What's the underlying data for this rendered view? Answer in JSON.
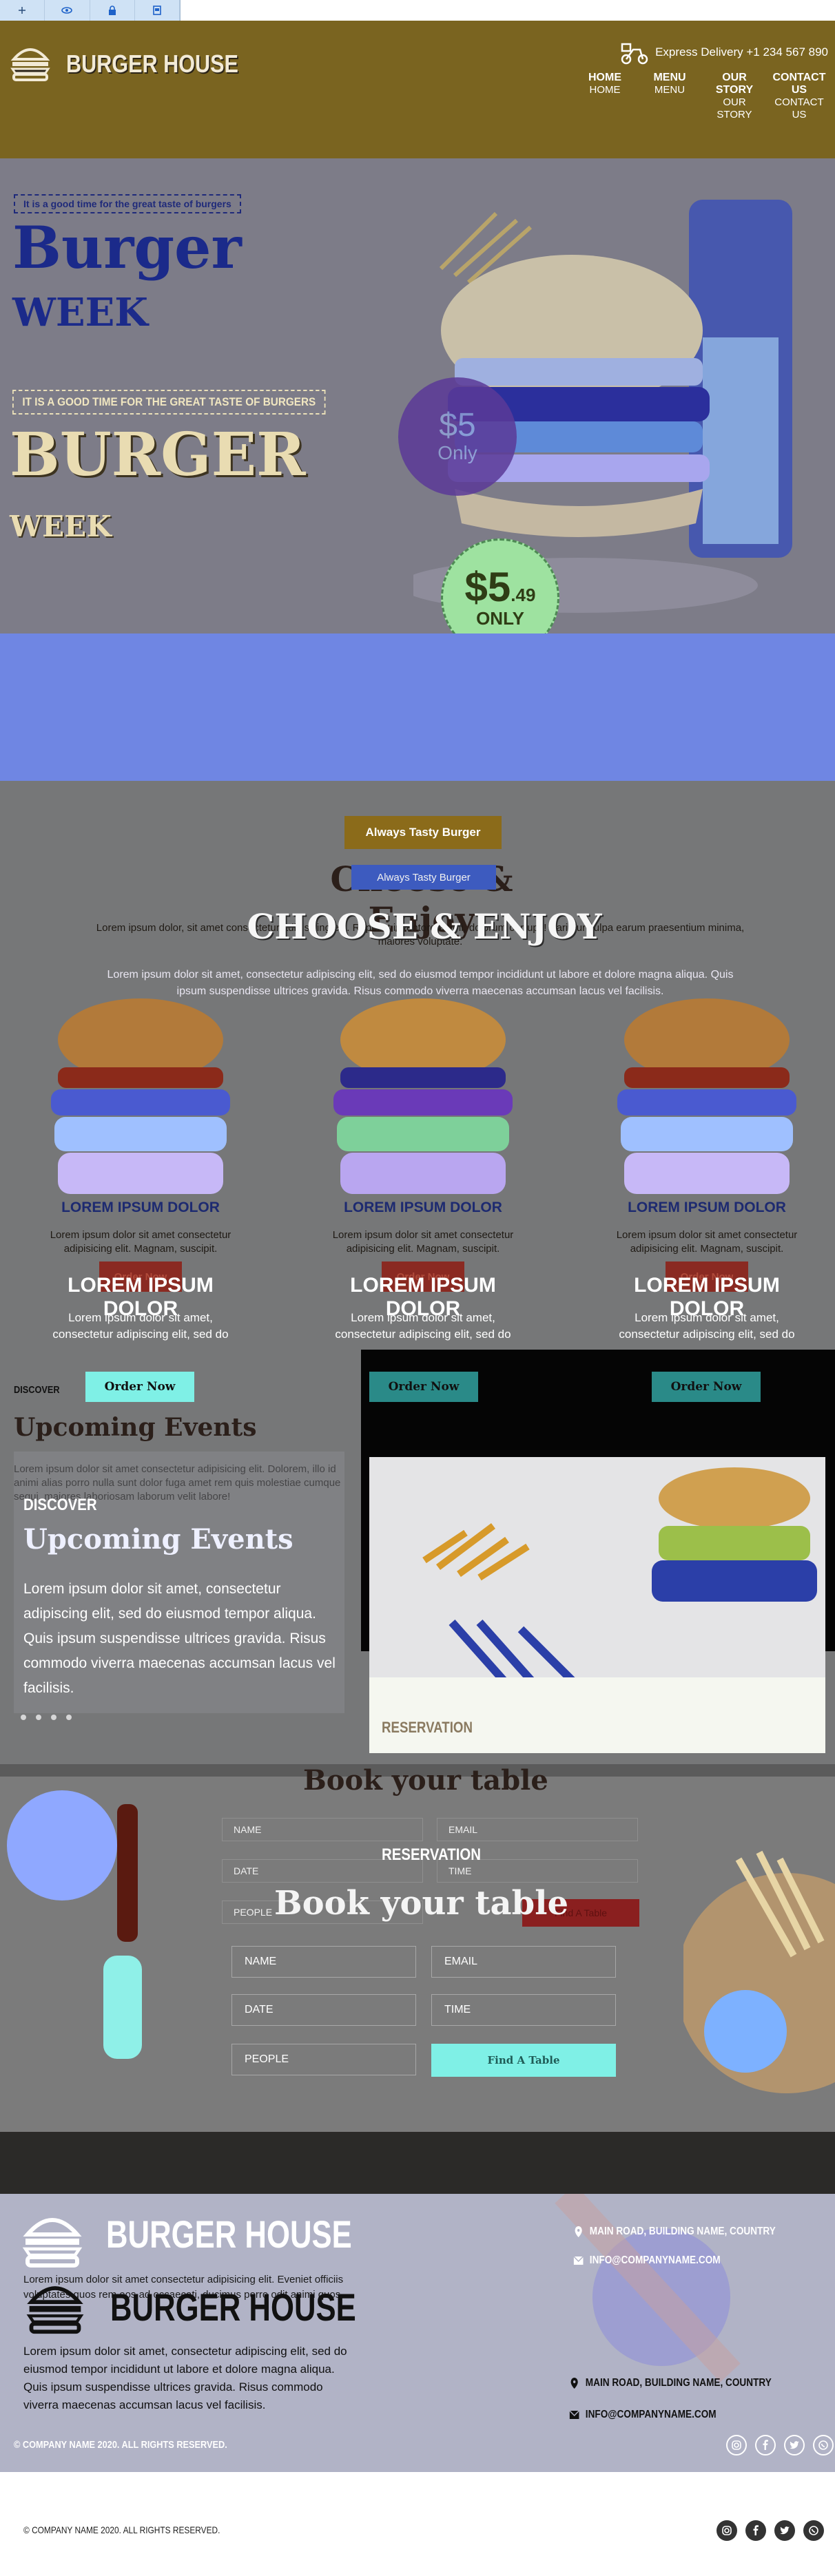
{
  "toolbar": {
    "icons": [
      "collapse-icon",
      "eye-icon",
      "lock-icon",
      "page-icon"
    ]
  },
  "header": {
    "brand": "BURGER HOUSE",
    "delivery": "Express Delivery +1 234 567 890",
    "nav": [
      {
        "label": "HOME",
        "label2": "HOME"
      },
      {
        "label": "MENU",
        "label2": "MENU"
      },
      {
        "label": "OUR STORY",
        "label2": "OUR STORY"
      },
      {
        "label": "CONTACT US",
        "label2": "CONTACT US"
      }
    ]
  },
  "hero": {
    "tag_small": "It is a good time for the great taste of burgers",
    "title_1": "Burger",
    "title_2": "WEEK",
    "tag_caps": "IT IS A GOOD TIME FOR THE GREAT TASTE OF BURGERS",
    "title_3": "BURGER",
    "title_4": "WEEK",
    "price_ghost": "$5",
    "price_ghost_sub": "Only",
    "price_main": "$5",
    "price_cents": ".49",
    "price_only": "ONLY"
  },
  "menu": {
    "pill_1": "Always Tasty Burger",
    "pill_2": "Always Tasty Burger",
    "heading_ghost": "Choose & Enjoy",
    "heading": "CHOOSE & ENJOY",
    "lead_1": "Lorem ipsum dolor, sit amet consectetur adipisicing elit. Repellat inventore animi, dolorum corrupti! Pariatur culpa earum praesentium minima, maiores voluptate.",
    "lead_2": "Lorem ipsum dolor sit amet, consectetur adipiscing elit, sed do eiusmod tempor incididunt ut labore et dolore magna aliqua. Quis ipsum suspendisse ultrices gravida. Risus commodo viverra maecenas accumsan lacus vel facilisis.",
    "cards": [
      {
        "name_a": "LOREM IPSUM DOLOR",
        "desc_a": "Lorem ipsum dolor sit amet consectetur adipisicing elit. Magnam, suscipit.",
        "btn_a": "Order Now",
        "name_b": "LOREM IPSUM DOLOR",
        "desc_b": "Lorem ipsum dolor sit amet, consectetur adipiscing elit, sed do",
        "btn_b": "Order Now"
      },
      {
        "name_a": "LOREM IPSUM DOLOR",
        "desc_a": "Lorem ipsum dolor sit amet consectetur adipisicing elit. Magnam, suscipit.",
        "btn_a": "Order Now",
        "name_b": "LOREM IPSUM DOLOR",
        "desc_b": "Lorem ipsum dolor sit amet, consectetur adipiscing elit, sed do",
        "btn_b": "Order Now"
      },
      {
        "name_a": "LOREM IPSUM DOLOR",
        "desc_a": "Lorem ipsum dolor sit amet consectetur adipisicing elit. Magnam, suscipit.",
        "btn_a": "Order Now",
        "name_b": "LOREM IPSUM DOLOR",
        "desc_b": "Lorem ipsum dolor sit amet, consectetur adipiscing elit, sed do",
        "btn_b": "Order Now"
      }
    ]
  },
  "events": {
    "discover_1": "DISCOVER",
    "heading_1": "Upcoming Events",
    "text_1": "Lorem ipsum dolor sit amet consectetur adipisicing elit. Dolorem, illo id animi alias porro nulla sunt dolor fuga amet rem quis molestiae cumque sequi, maiores laboriosam laborum velit labore!",
    "discover_2": "DISCOVER",
    "heading_2": "Upcoming Events",
    "text_2": "Lorem ipsum dolor sit amet, consectetur adipiscing elit, sed do eiusmod tempor aliqua. Quis ipsum suspendisse ultrices gravida. Risus commodo viverra maecenas accumsan lacus vel facilisis.",
    "reservation_label": "RESERVATION"
  },
  "booking": {
    "heading_ghost": "Book your table",
    "reservation": "RESERVATION",
    "heading": "Book your table",
    "ghost_fields": {
      "name": "NAME",
      "email": "EMAIL",
      "date": "DATE",
      "time": "TIME",
      "people": "PEOPLE",
      "btn": "Find A Table"
    },
    "fields": {
      "name": "NAME",
      "email": "EMAIL",
      "date": "DATE",
      "time": "TIME",
      "people": "PEOPLE"
    },
    "submit": "Find A Table"
  },
  "footer": {
    "brand_1": "BURGER HOUSE",
    "brand_2": "BURGER HOUSE",
    "text_1": "Lorem ipsum dolor sit amet consectetur adipisicing elit. Eveniet officiis voluptates quos rem eos ad occaecati, ducimus porro odit animi quos.",
    "text_2": "Lorem ipsum dolor sit amet, consectetur adipiscing elit, sed do eiusmod tempor incididunt ut labore et dolore magna aliqua. Quis ipsum suspendisse ultrices gravida. Risus commodo viverra maecenas accumsan lacus vel facilisis.",
    "address_1": "MAIN ROAD, BUILDING NAME, COUNTRY",
    "email_1": "INFO@COMPANYNAME.COM",
    "address_2": "MAIN ROAD, BUILDING NAME, COUNTRY",
    "email_2": "INFO@COMPANYNAME.COM",
    "copyright_1": "© COMPANY NAME 2020. ALL RIGHTS RESERVED.",
    "copyright_2": "© COMPANY NAME 2020. ALL RIGHTS RESERVED.",
    "social": [
      "instagram-icon",
      "facebook-icon",
      "twitter-icon",
      "whatsapp-icon"
    ]
  },
  "colors": {
    "header": "#7a6420",
    "hero": "#7d7c88",
    "accent_teal": "#7ff0e6",
    "accent_red": "#8a2a22",
    "footer": "#b1b3c6"
  }
}
